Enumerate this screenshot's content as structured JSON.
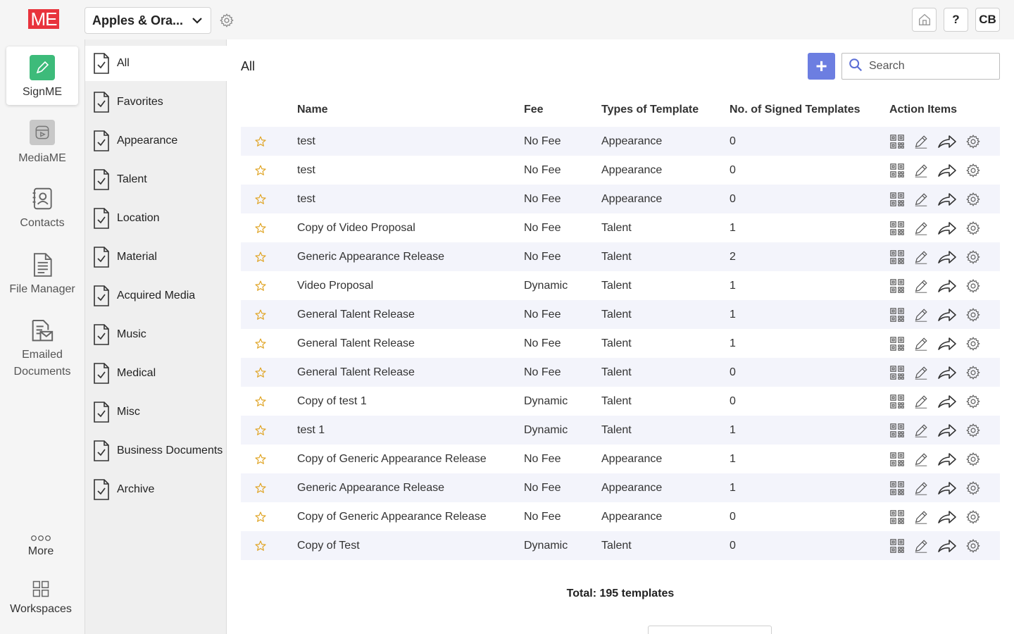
{
  "topbar": {
    "logo_text": "ME",
    "workspace_name": "Apples & Ora...",
    "user_initials": "CB",
    "help_label": "?"
  },
  "rail": {
    "items": [
      {
        "label": "SignME",
        "icon": "pen-icon"
      },
      {
        "label": "MediaME",
        "icon": "media-icon"
      },
      {
        "label": "Contacts",
        "icon": "contacts-icon"
      },
      {
        "label": "File Manager",
        "icon": "file-icon"
      },
      {
        "label": "Emailed Documents",
        "icon": "email-doc-icon"
      }
    ],
    "more_label": "More",
    "workspaces_label": "Workspaces"
  },
  "categories": [
    "All",
    "Favorites",
    "Appearance",
    "Talent",
    "Location",
    "Material",
    "Acquired Media",
    "Music",
    "Medical",
    "Misc",
    "Business Documents",
    "Archive"
  ],
  "main": {
    "title": "All",
    "add_label": "+",
    "search_placeholder": "Search"
  },
  "table": {
    "headers": {
      "name": "Name",
      "fee": "Fee",
      "type": "Types of Template",
      "signed": "No. of Signed Templates",
      "actions": "Action Items"
    },
    "rows": [
      {
        "name": "test",
        "fee": "No Fee",
        "type": "Appearance",
        "signed": "0"
      },
      {
        "name": "test",
        "fee": "No Fee",
        "type": "Appearance",
        "signed": "0"
      },
      {
        "name": "test",
        "fee": "No Fee",
        "type": "Appearance",
        "signed": "0"
      },
      {
        "name": "Copy of Video Proposal",
        "fee": "No Fee",
        "type": "Talent",
        "signed": "1"
      },
      {
        "name": "Generic Appearance Release",
        "fee": "No Fee",
        "type": "Talent",
        "signed": "2"
      },
      {
        "name": "Video Proposal",
        "fee": "Dynamic",
        "type": "Talent",
        "signed": "1"
      },
      {
        "name": "General Talent Release",
        "fee": "No Fee",
        "type": "Talent",
        "signed": "1"
      },
      {
        "name": "General Talent Release",
        "fee": "No Fee",
        "type": "Talent",
        "signed": "1"
      },
      {
        "name": "General Talent Release",
        "fee": "No Fee",
        "type": "Talent",
        "signed": "0"
      },
      {
        "name": "Copy of test 1",
        "fee": "Dynamic",
        "type": "Talent",
        "signed": "0"
      },
      {
        "name": "test 1",
        "fee": "Dynamic",
        "type": "Talent",
        "signed": "1"
      },
      {
        "name": "Copy of Generic Appearance Release",
        "fee": "No Fee",
        "type": "Appearance",
        "signed": "1"
      },
      {
        "name": "Generic Appearance Release",
        "fee": "No Fee",
        "type": "Appearance",
        "signed": "1"
      },
      {
        "name": "Copy of Generic Appearance Release",
        "fee": "No Fee",
        "type": "Appearance",
        "signed": "0"
      },
      {
        "name": "Copy of Test",
        "fee": "Dynamic",
        "type": "Talent",
        "signed": "0"
      }
    ],
    "total_text": "Total: 195 templates"
  },
  "colors": {
    "brand_red": "#e8333c",
    "accent_blue": "#6c7ee1",
    "star": "#e0a526",
    "signme_green": "#3dbb7a"
  }
}
